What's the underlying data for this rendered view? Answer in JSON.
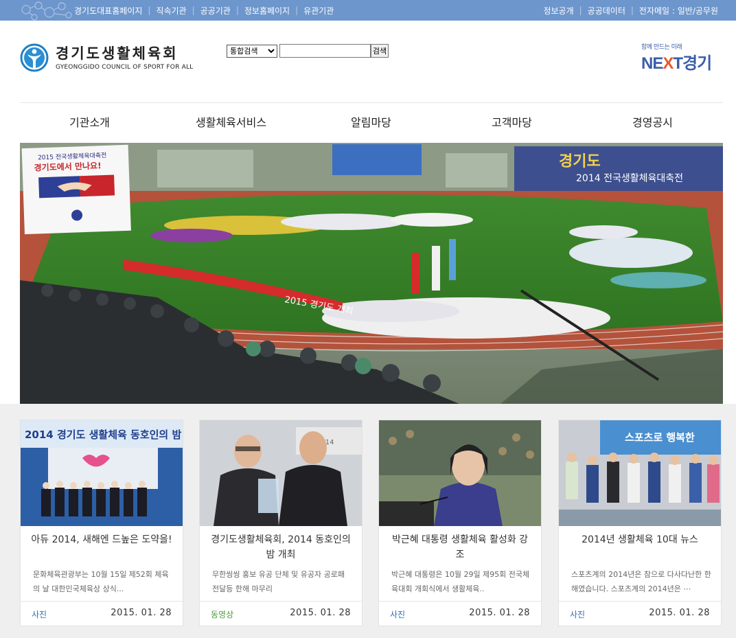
{
  "topbar": {
    "left_links": [
      "경기도대표홈페이지",
      "직속기관",
      "공공기관",
      "정보홈페이지",
      "유관기관"
    ],
    "right_links": [
      "정보공개",
      "공공데이터",
      "전자메일 : 일반/공무원"
    ],
    "separator": "|"
  },
  "header": {
    "logo_ko": "경기도생활체육회",
    "logo_en": "GYEONGGIDO COUNCIL OF SPORT FOR ALL",
    "search": {
      "select_value": "통합검색",
      "input_value": "",
      "button_label": "검색"
    },
    "next_logo": {
      "small": "함께 만드는 미래",
      "big_ne": "NE",
      "big_x": "X",
      "big_t": "T",
      "big_ko": "경기"
    }
  },
  "nav": {
    "items": [
      "기관소개",
      "생활체육서비스",
      "알림마당",
      "고객마당",
      "경영공시"
    ]
  },
  "hero": {
    "banner_left_line1": "2015 전국생활체육대축전",
    "banner_left_line2": "경기도에서 만나요!",
    "banner_right_line1": "경기도",
    "banner_right_line2": "2014 전국생활체육대축전",
    "track_banner": "2015 경기도 개최"
  },
  "cards": [
    {
      "thumb_caption": "2014 경기도 생활체육 동호인의 밤",
      "title": "아듀 2014, 새해엔 드높은 도약을!",
      "desc": "문화체육관광부는 10월 15일 제52회 체육의 날 대한민국체육상 상식...",
      "category": "사진",
      "date": "2015. 01. 28"
    },
    {
      "thumb_caption": "2014",
      "title": "경기도생활체육회, 2014 동호인의 밤 개최",
      "desc": "무한씽씽 홍보 유공 단체 및 유공자 공로패 전달등 한해 마무리",
      "category": "동영상",
      "date": "2015. 01. 28"
    },
    {
      "thumb_caption": "",
      "title": "박근혜 대통령 생활체육 활성화 강조",
      "desc": "박근혜 대통령은 10월 29일 제95회 전국체육대회 개회식에서 생활체육..",
      "category": "사진",
      "date": "2015. 01. 28"
    },
    {
      "thumb_caption": "스포츠로 행복한",
      "title": "2014년 생활체육 10대 뉴스",
      "desc": "스포츠계의 2014년은 참으로 다사다난한 한 해였습니다. 스포츠계의 2014년은 ⋯",
      "category": "사진",
      "date": "2015. 01. 28"
    }
  ],
  "colors": {
    "topbar": "#6d96cc",
    "brand_blue": "#3a5da8",
    "category_photo": "#2f6fb3",
    "category_video": "#4a9a3a",
    "lower_bg": "#efefef"
  }
}
